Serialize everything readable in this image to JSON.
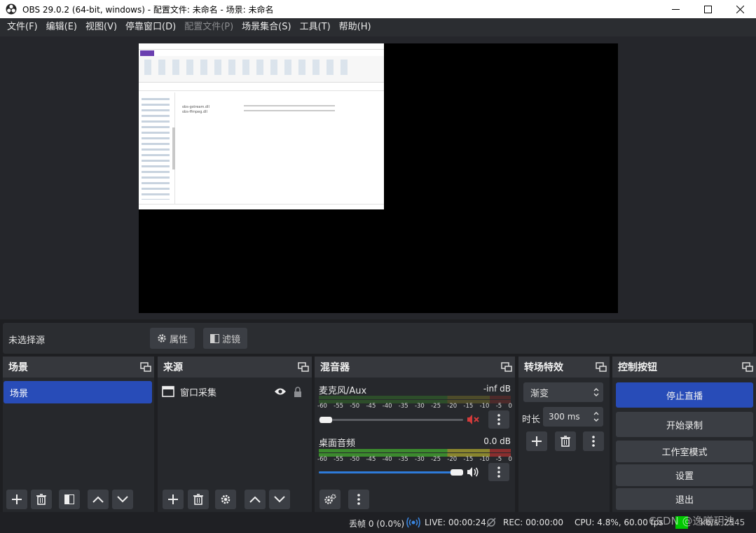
{
  "window": {
    "title": "OBS 29.0.2 (64-bit, windows) - 配置文件: 未命名 - 场景: 未命名"
  },
  "menu": [
    {
      "label": "文件(F)",
      "disabled": false
    },
    {
      "label": "编辑(E)",
      "disabled": false
    },
    {
      "label": "视图(V)",
      "disabled": false
    },
    {
      "label": "停靠窗口(D)",
      "disabled": false
    },
    {
      "label": "配置文件(P)",
      "disabled": true
    },
    {
      "label": "场景集合(S)",
      "disabled": false
    },
    {
      "label": "工具(T)",
      "disabled": false
    },
    {
      "label": "帮助(H)",
      "disabled": false
    }
  ],
  "source_bar": {
    "no_source": "未选择源",
    "properties": "属性",
    "filters": "滤镜"
  },
  "docks": {
    "scenes": {
      "title": "场景",
      "items": [
        "场景"
      ]
    },
    "sources": {
      "title": "来源",
      "items": [
        "窗口采集"
      ]
    },
    "mixer": {
      "title": "混音器",
      "channels": [
        {
          "name": "麦克风/Aux",
          "db": "-inf dB",
          "muted": true,
          "volume": 0.02
        },
        {
          "name": "桌面音频",
          "db": "0.0 dB",
          "muted": false,
          "volume": 1.0
        }
      ],
      "ticks": [
        "-60",
        "-55",
        "-50",
        "-45",
        "-40",
        "-35",
        "-30",
        "-25",
        "-20",
        "-15",
        "-10",
        "-5",
        "0"
      ]
    },
    "transitions": {
      "title": "转场特效",
      "selected": "渐变",
      "duration_label": "时长",
      "duration_value": "300 ms"
    },
    "controls": {
      "title": "控制按钮",
      "stop_stream": "停止直播",
      "start_record": "开始录制",
      "studio_mode": "工作室模式",
      "settings": "设置",
      "exit": "退出"
    }
  },
  "status": {
    "dropped": "丢帧 0 (0.0%)",
    "live": "LIVE: 00:00:24",
    "rec": "REC: 00:00:00",
    "cpu": "CPU: 4.8%, 60.00 fps",
    "bitrate": "kb/s: 2545",
    "watermark": "CSDN @逸曦玥泱"
  },
  "colors": {
    "accent": "#284cb8",
    "meter_green": "#3c8a2e",
    "meter_yellow": "#8a862e",
    "meter_red": "#8a2e2e",
    "mute_red": "#d33b3b",
    "slider_blue": "#2e7bd9",
    "status_ok": "#00c800"
  },
  "explorer_preview": {
    "files": [
      "obs-gstream.dll",
      "obs-ffmpeg.dll"
    ]
  }
}
